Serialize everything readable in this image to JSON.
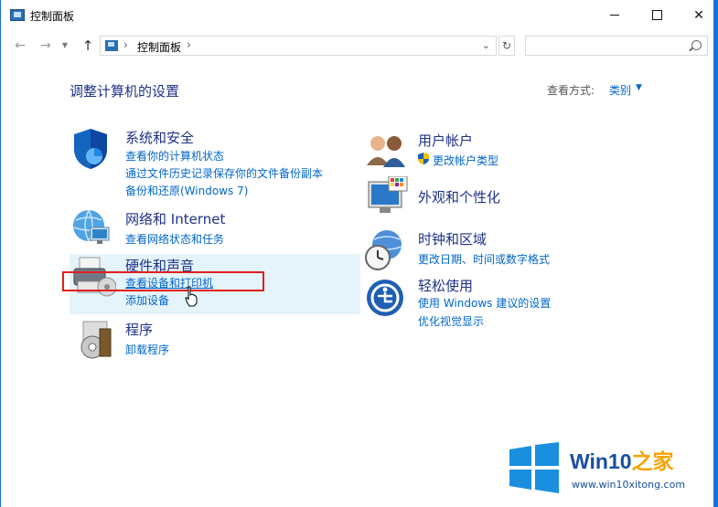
{
  "window": {
    "title": "控制面板"
  },
  "address": {
    "path": "控制面板",
    "search_placeholder": ""
  },
  "header": {
    "heading": "调整计算机的设置",
    "view_by_label": "查看方式:",
    "view_by_value": "类别"
  },
  "categories_left": [
    {
      "title": "系统和安全",
      "links": [
        "查看你的计算机状态",
        "通过文件历史记录保存你的文件备份副本",
        "备份和还原(Windows 7)"
      ]
    },
    {
      "title": "网络和 Internet",
      "links": [
        "查看网络状态和任务"
      ]
    },
    {
      "title": "硬件和声音",
      "links": [
        "查看设备和打印机",
        "添加设备"
      ]
    },
    {
      "title": "程序",
      "links": [
        "卸载程序"
      ]
    }
  ],
  "categories_right": [
    {
      "title": "用户帐户",
      "links": [
        "更改帐户类型"
      ]
    },
    {
      "title": "外观和个性化",
      "links": []
    },
    {
      "title": "时钟和区域",
      "links": [
        "更改日期、时间或数字格式"
      ]
    },
    {
      "title": "轻松使用",
      "links": [
        "使用 Windows 建议的设置",
        "优化视觉显示"
      ]
    }
  ],
  "watermark": {
    "title_part1": "Win10",
    "title_part2": "之家",
    "url": "www.win10xitong.com"
  },
  "colors": {
    "accent": "#0066cc",
    "heading": "#1e3287",
    "highlight": "#e02020",
    "hover": "#e5f3fb"
  }
}
